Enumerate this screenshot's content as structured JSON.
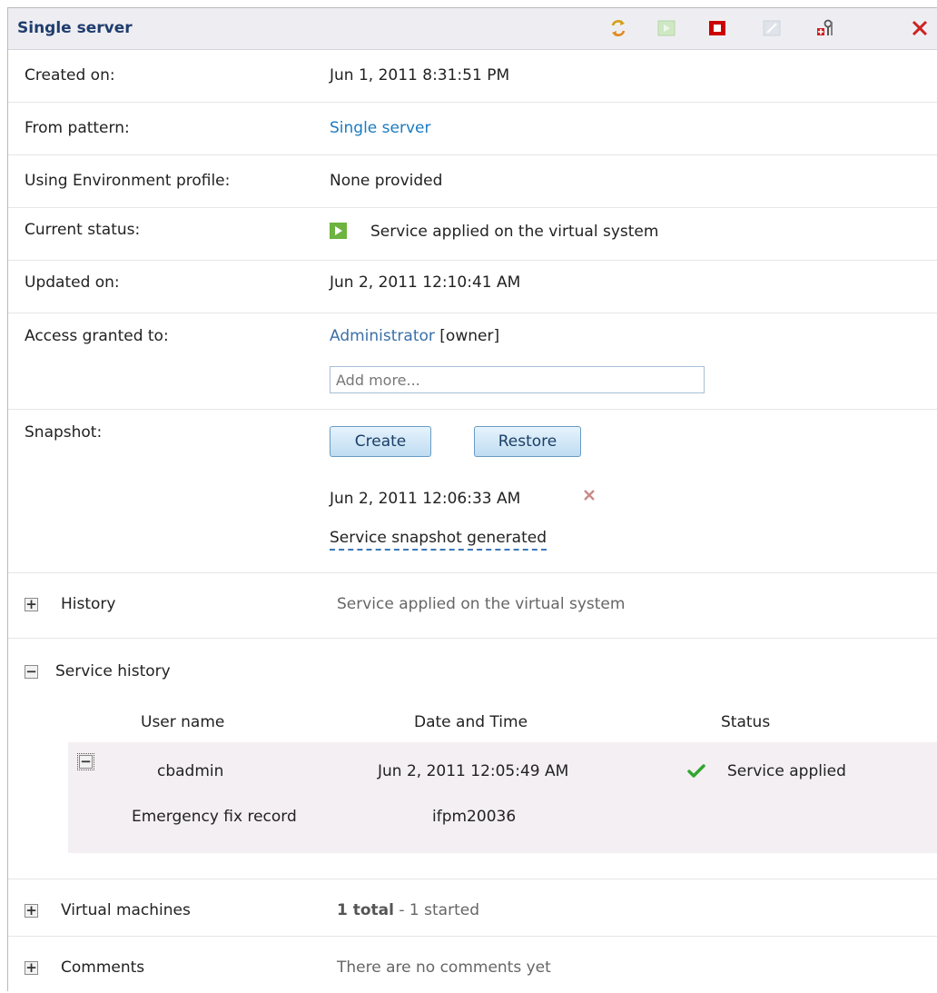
{
  "panel": {
    "title": "Single server"
  },
  "toolbar": {
    "icons": [
      "refresh-icon",
      "start-icon",
      "stop-icon",
      "edit-icon",
      "maintenance-icon",
      "delete-icon"
    ],
    "colors": {
      "stop": "#cc0000",
      "delete": "#cc2222",
      "start": "#7ac143"
    }
  },
  "details": {
    "created_on": {
      "label": "Created on:",
      "value": "Jun 1, 2011 8:31:51 PM"
    },
    "from_pattern": {
      "label": "From pattern:",
      "value": "Single server"
    },
    "env_profile": {
      "label": "Using Environment profile:",
      "value": "None provided"
    },
    "status": {
      "label": "Current status:",
      "value": "Service applied on the virtual system"
    },
    "updated_on": {
      "label": "Updated on:",
      "value": "Jun 2, 2011 12:10:41 AM"
    },
    "access": {
      "label": "Access granted to:",
      "user": "Administrator",
      "role": "[owner]",
      "add_placeholder": "Add more..."
    },
    "snapshot": {
      "label": "Snapshot:",
      "create_label": "Create",
      "restore_label": "Restore",
      "date": "Jun 2, 2011 12:06:33 AM",
      "description": "Service snapshot generated"
    }
  },
  "sections": {
    "history": {
      "label": "History",
      "summary": "Service applied on the virtual system"
    },
    "service_history": {
      "label": "Service history",
      "columns": [
        "User name",
        "Date and Time",
        "Status"
      ],
      "rows": [
        {
          "user": "cbadmin",
          "datetime": "Jun 2, 2011 12:05:49 AM",
          "status": "Service applied",
          "detail_label": "Emergency fix record",
          "detail_value": "ifpm20036"
        }
      ]
    },
    "virtual_machines": {
      "label": "Virtual machines",
      "total": "1 total",
      "started": " - 1 started"
    },
    "comments": {
      "label": "Comments",
      "summary": "There are no comments yet"
    }
  }
}
